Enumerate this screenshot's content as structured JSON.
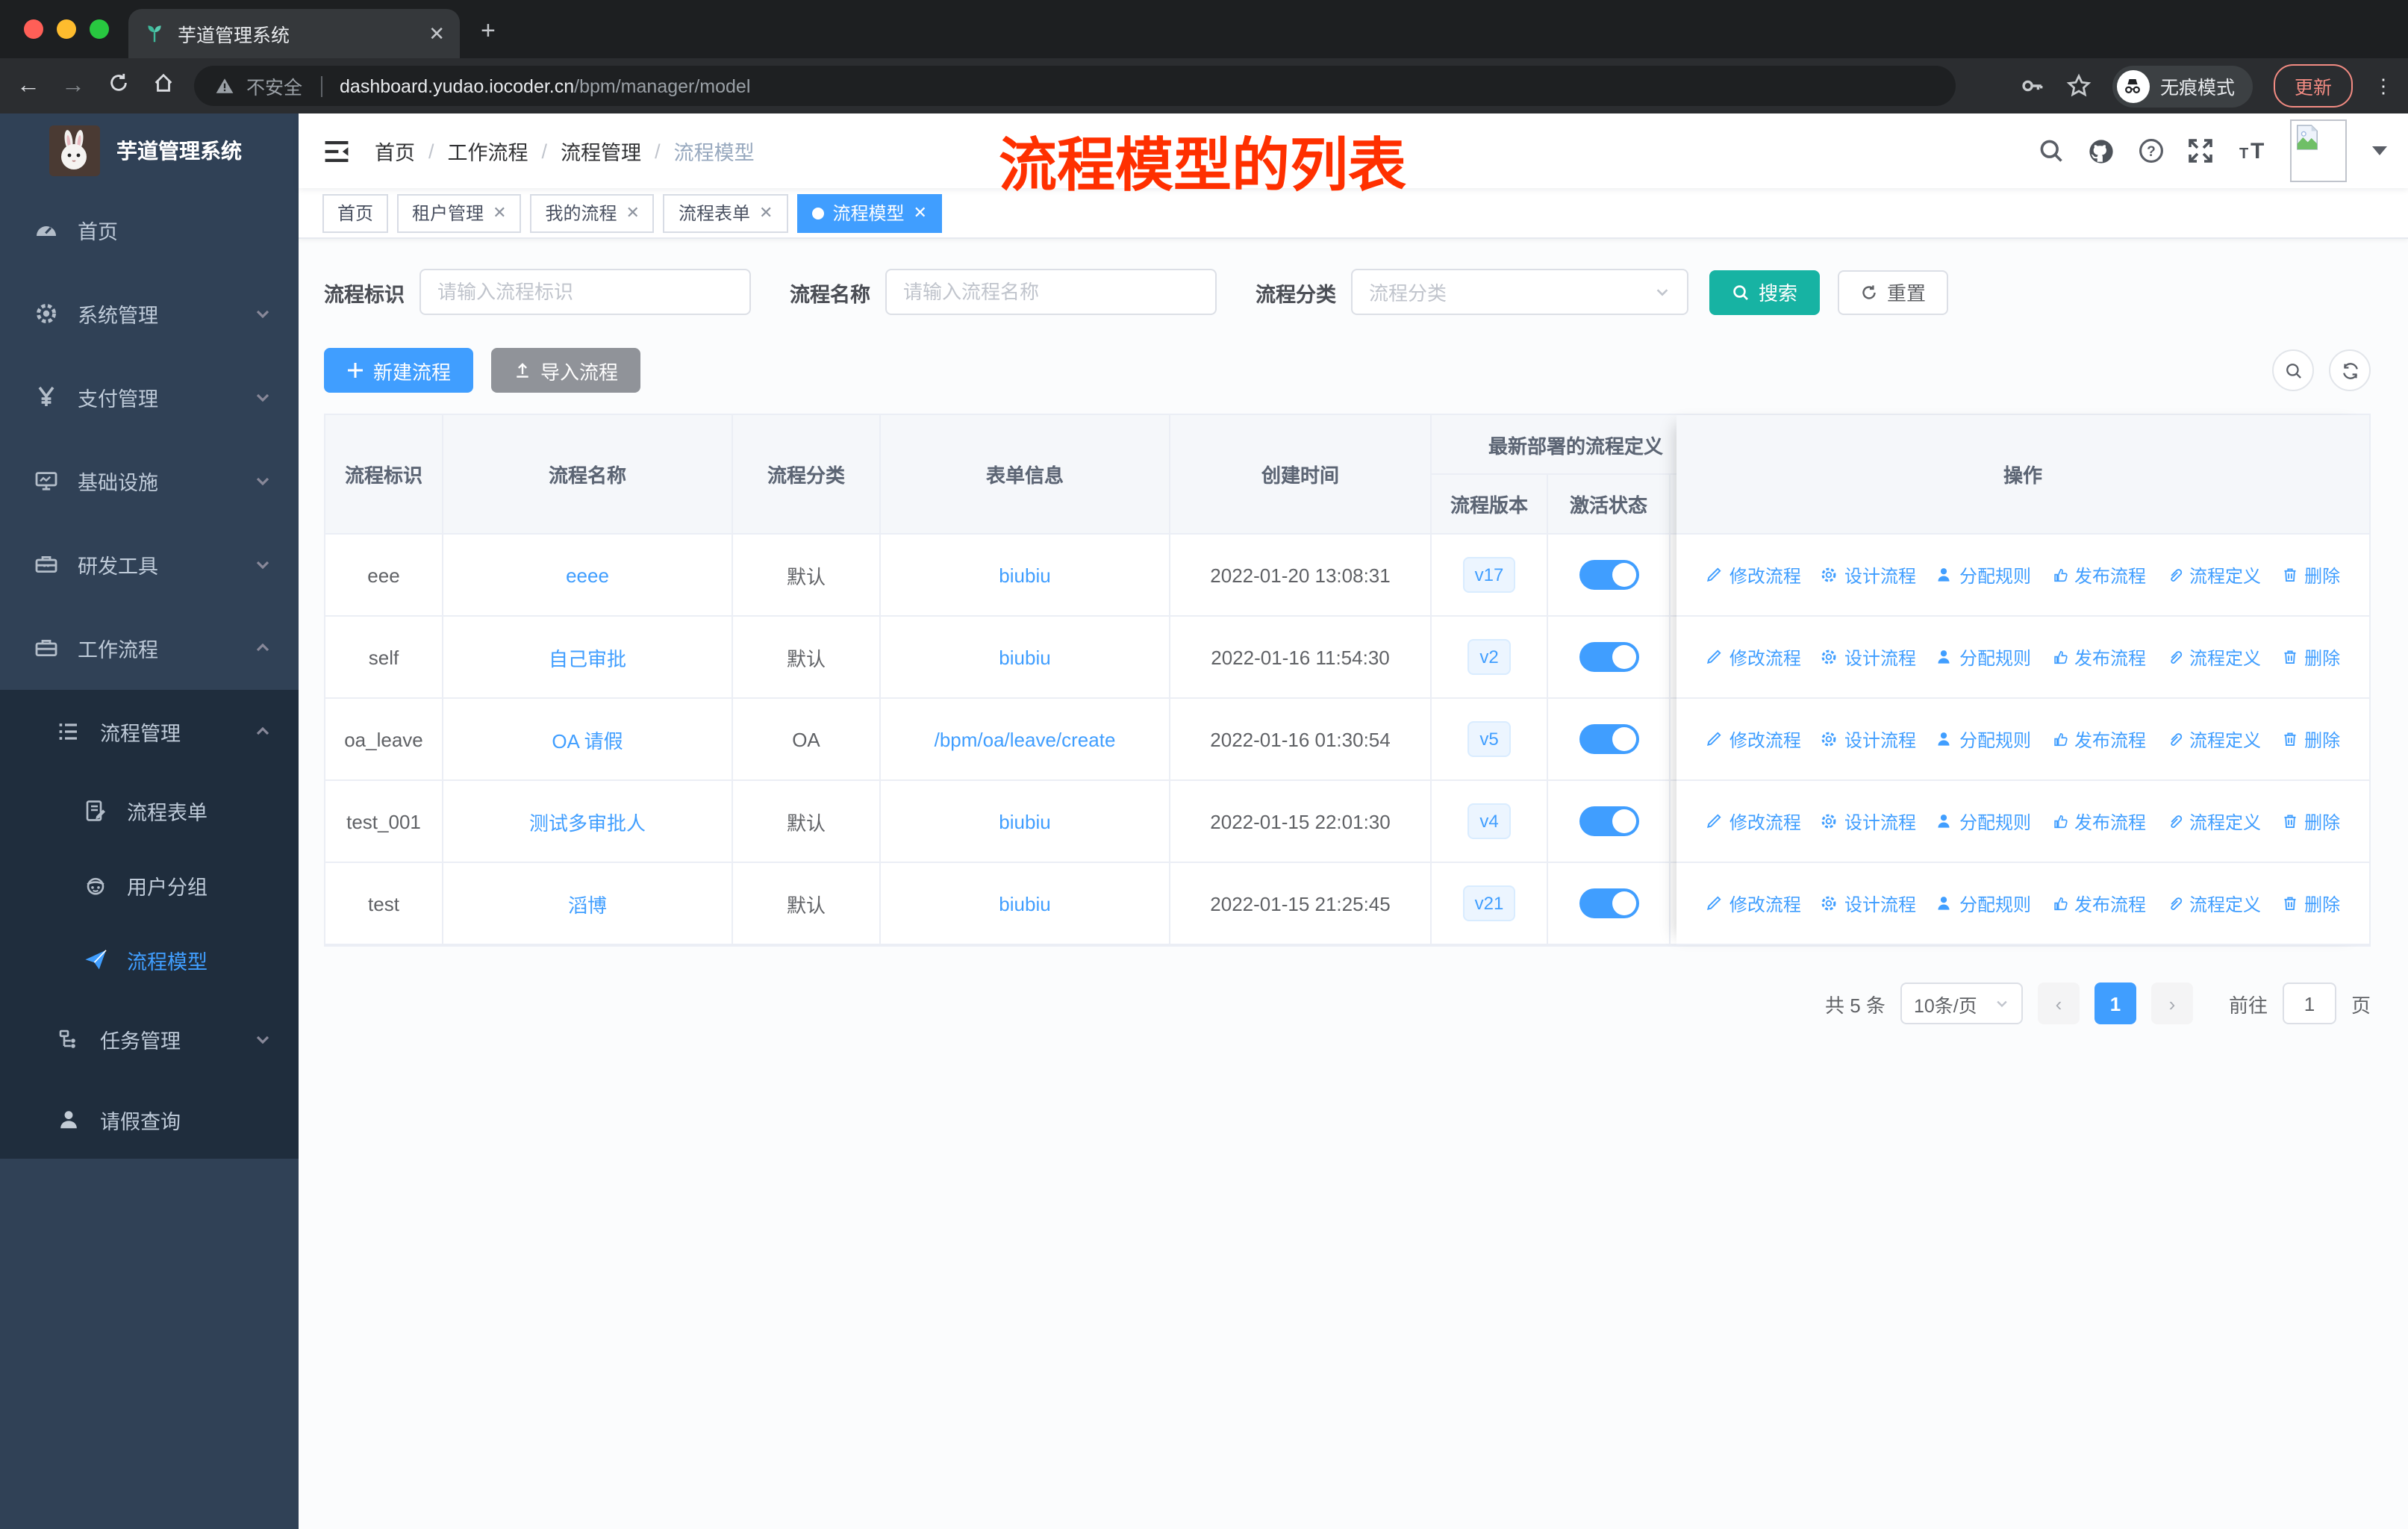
{
  "browser": {
    "tab_title": "芋道管理系统",
    "new_tab": "+",
    "close_tab": "✕",
    "security_label": "不安全",
    "url_host": "dashboard.yudao.iocoder.cn",
    "url_path": "/bpm/manager/model",
    "incognito_label": "无痕模式",
    "update_button": "更新"
  },
  "annotation": "流程模型的列表",
  "colors": {
    "accent_blue": "#409eff",
    "search_teal": "#17b3a3",
    "sidebar_bg": "#304156",
    "sidebar_submenu_bg": "#1f2d3d",
    "annotation_red": "#ff3000",
    "tag_active_bg": "#409eff",
    "import_gray": "#909399"
  },
  "sidebar": {
    "title": "芋道管理系统",
    "items": [
      {
        "label": "首页"
      },
      {
        "label": "系统管理"
      },
      {
        "label": "支付管理"
      },
      {
        "label": "基础设施"
      },
      {
        "label": "研发工具"
      },
      {
        "label": "工作流程"
      },
      {
        "label": "流程管理"
      },
      {
        "label": "流程表单"
      },
      {
        "label": "用户分组"
      },
      {
        "label": "流程模型"
      },
      {
        "label": "任务管理"
      },
      {
        "label": "请假查询"
      }
    ]
  },
  "breadcrumb": [
    "首页",
    "工作流程",
    "流程管理",
    "流程模型"
  ],
  "tags": [
    {
      "label": "首页"
    },
    {
      "label": "租户管理"
    },
    {
      "label": "我的流程"
    },
    {
      "label": "流程表单"
    },
    {
      "label": "流程模型"
    }
  ],
  "filters": {
    "key_label": "流程标识",
    "key_placeholder": "请输入流程标识",
    "name_label": "流程名称",
    "name_placeholder": "请输入流程名称",
    "category_label": "流程分类",
    "category_placeholder": "流程分类",
    "search_button": "搜索",
    "reset_button": "重置"
  },
  "toolbar": {
    "create_button": "新建流程",
    "import_button": "导入流程"
  },
  "table": {
    "headers": {
      "key": "流程标识",
      "name": "流程名称",
      "category": "流程分类",
      "form": "表单信息",
      "created": "创建时间",
      "group": "最新部署的流程定义",
      "version": "流程版本",
      "state": "激活状态",
      "operation": "操作"
    },
    "actions": [
      "修改流程",
      "设计流程",
      "分配规则",
      "发布流程",
      "流程定义",
      "删除"
    ],
    "rows": [
      {
        "key": "eee",
        "name": "eeee",
        "category": "默认",
        "form": "biubiu",
        "created": "2022-01-20 13:08:31",
        "version": "v17",
        "active": true
      },
      {
        "key": "self",
        "name": "自己审批",
        "category": "默认",
        "form": "biubiu",
        "created": "2022-01-16 11:54:30",
        "version": "v2",
        "active": true
      },
      {
        "key": "oa_leave",
        "name": "OA 请假",
        "category": "OA",
        "form": "/bpm/oa/leave/create",
        "created": "2022-01-16 01:30:54",
        "version": "v5",
        "active": true
      },
      {
        "key": "test_001",
        "name": "测试多审批人",
        "category": "默认",
        "form": "biubiu",
        "created": "2022-01-15 22:01:30",
        "version": "v4",
        "active": true
      },
      {
        "key": "test",
        "name": "滔博",
        "category": "默认",
        "form": "biubiu",
        "created": "2022-01-15 21:25:45",
        "version": "v21",
        "active": true
      }
    ]
  },
  "pagination": {
    "total": "共 5 条",
    "page_size": "10条/页",
    "prev": "‹",
    "current": "1",
    "next": "›",
    "goto_label": "前往",
    "goto_value": "1",
    "page_suffix": "页"
  }
}
